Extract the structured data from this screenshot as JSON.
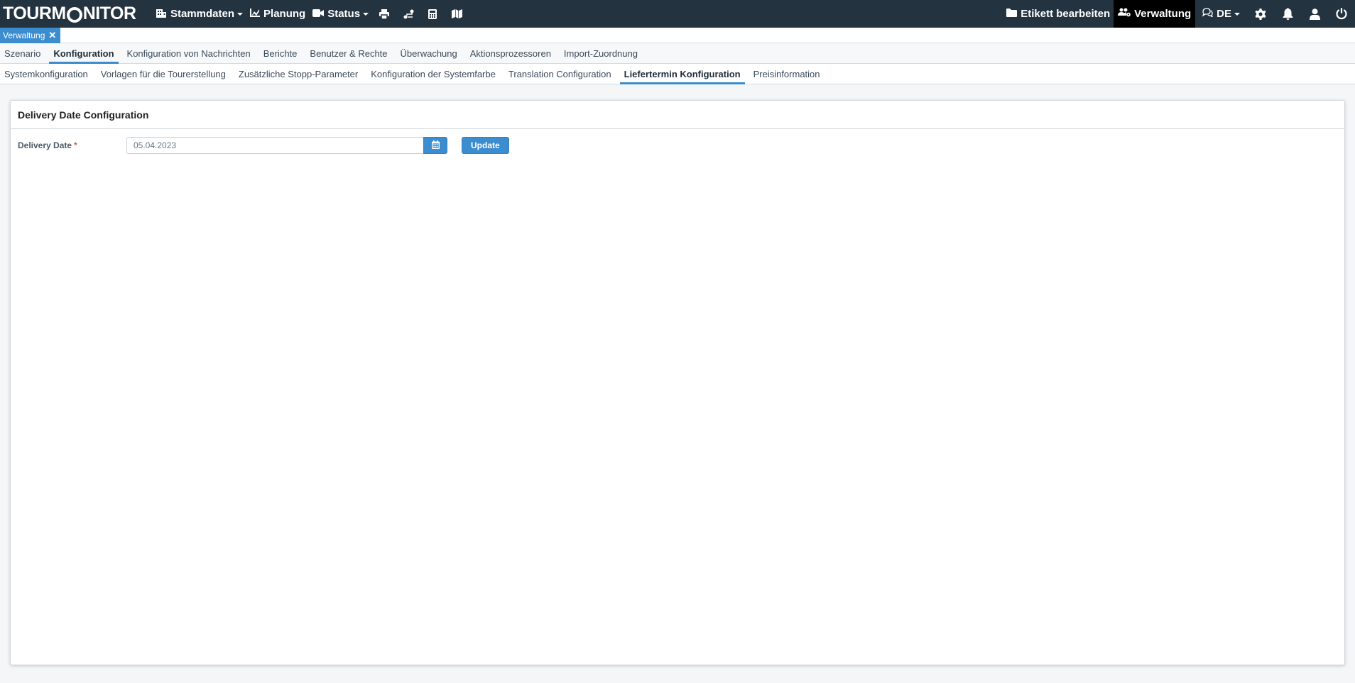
{
  "navbar": {
    "logo_pre": "TOURM",
    "logo_post": "NITOR",
    "items": [
      {
        "label": "Stammdaten",
        "icon": "building-icon",
        "dropdown": true
      },
      {
        "label": "Planung",
        "icon": "chart-icon",
        "dropdown": false
      },
      {
        "label": "Status",
        "icon": "video-icon",
        "dropdown": true
      }
    ],
    "tool_icons": [
      "print-icon",
      "route-icon",
      "calculator-icon",
      "map-icon"
    ],
    "right": {
      "edit_label": "Etikett bearbeiten",
      "admin_label": "Verwaltung",
      "language": "DE",
      "icons": [
        "gear-icon",
        "bell-icon",
        "user-icon",
        "power-icon"
      ]
    }
  },
  "open_tabs": [
    {
      "label": "Verwaltung",
      "close": "✕"
    }
  ],
  "main_tabs": [
    {
      "label": "Szenario",
      "active": false
    },
    {
      "label": "Konfiguration",
      "active": true
    },
    {
      "label": "Konfiguration von Nachrichten",
      "active": false
    },
    {
      "label": "Berichte",
      "active": false
    },
    {
      "label": "Benutzer & Rechte",
      "active": false
    },
    {
      "label": "Überwachung",
      "active": false
    },
    {
      "label": "Aktionsprozessoren",
      "active": false
    },
    {
      "label": "Import-Zuordnung",
      "active": false
    }
  ],
  "sub_tabs": [
    {
      "label": "Systemkonfiguration",
      "active": false
    },
    {
      "label": "Vorlagen für die Tourerstellung",
      "active": false
    },
    {
      "label": "Zusätzliche Stopp-Parameter",
      "active": false
    },
    {
      "label": "Konfiguration der Systemfarbe",
      "active": false
    },
    {
      "label": "Translation Configuration",
      "active": false
    },
    {
      "label": "Liefertermin Konfiguration",
      "active": true
    },
    {
      "label": "Preisinformation",
      "active": false
    }
  ],
  "panel": {
    "title": "Delivery Date Configuration",
    "field_label": "Delivery Date",
    "required_mark": "*",
    "date_value": "05.04.2023",
    "update_label": "Update"
  },
  "colors": {
    "navbar_bg": "#243340",
    "accent": "#3b8dd0",
    "active_nav_bg": "#000000"
  }
}
